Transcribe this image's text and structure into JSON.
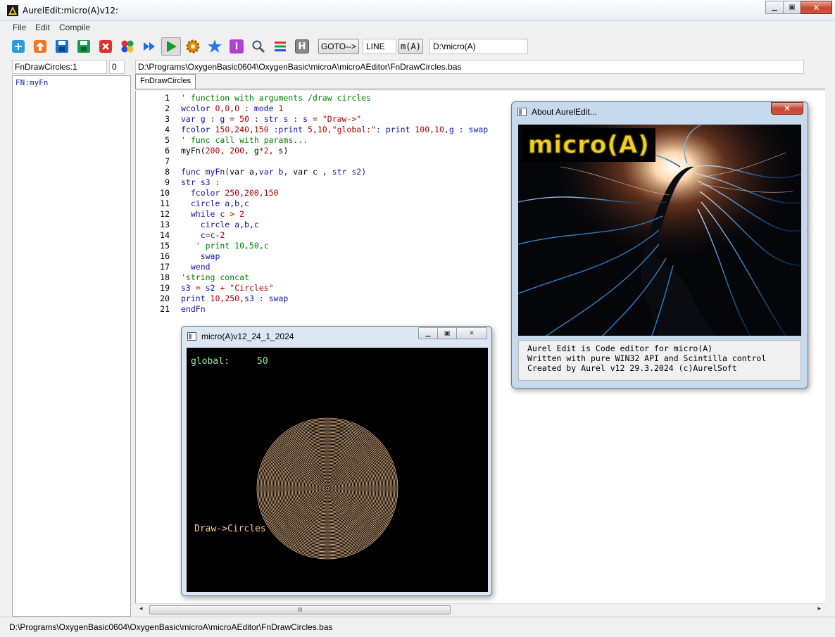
{
  "window": {
    "title": "AurelEdit:micro(A)v12:",
    "minimize_glyph": "▁",
    "maximize_glyph": "▣",
    "close_glyph": "✕"
  },
  "menu": {
    "items": [
      {
        "label": "File"
      },
      {
        "label": "Edit"
      },
      {
        "label": "Compile"
      }
    ]
  },
  "toolbar": {
    "goto_label": "GOTO-->",
    "line_value": "LINE",
    "ma_label": "m(A)",
    "path_value": "D:\\micro(A)",
    "info_glyph": "i",
    "h_glyph": "H"
  },
  "row2": {
    "function_name": "FnDrawCircles:1",
    "number": "0",
    "file_path": "D:\\Programs\\OxygenBasic0604\\OxygenBasic\\microA\\microAEditor\\FnDrawCircles.bas"
  },
  "sidebar": {
    "items": [
      {
        "label": "FN:myFn"
      }
    ]
  },
  "editor": {
    "tab_label": "FnDrawCircles",
    "line_numbers": [
      "1",
      "2",
      "3",
      "4",
      "5",
      "6",
      "7",
      "8",
      "9",
      "10",
      "11",
      "12",
      "13",
      "14",
      "15",
      "16",
      "17",
      "18",
      "19",
      "20",
      "21"
    ],
    "lines": [
      [
        [
          "c-com",
          "' function with arguments /draw circles"
        ]
      ],
      [
        [
          "c-kw",
          "wcolor "
        ],
        [
          "c-num",
          "0,0,0"
        ],
        [
          "c-kw",
          " : mode "
        ],
        [
          "c-num",
          "1"
        ]
      ],
      [
        [
          "c-kw",
          "var g : g "
        ],
        [
          "c-op",
          "="
        ],
        [
          "c-num",
          " 50"
        ],
        [
          "c-kw",
          " : str s : s "
        ],
        [
          "c-op",
          "="
        ],
        [
          "c-str",
          " \"Draw->\""
        ]
      ],
      [
        [
          "c-kw",
          "fcolor "
        ],
        [
          "c-num",
          "150,240,150"
        ],
        [
          "c-kw",
          " :print "
        ],
        [
          "c-num",
          "5,10,"
        ],
        [
          "c-str",
          "\"global:\""
        ],
        [
          "c-kw",
          ": print "
        ],
        [
          "c-num",
          "100,10,"
        ],
        [
          "c-kw",
          "g : swap"
        ]
      ],
      [
        [
          "c-com",
          "' func call with params..."
        ]
      ],
      [
        [
          "c-txt",
          "myFn("
        ],
        [
          "c-num",
          "200, 200,"
        ],
        [
          "c-txt",
          " g"
        ],
        [
          "c-op",
          "*"
        ],
        [
          "c-num",
          "2,"
        ],
        [
          "c-txt",
          " s)"
        ]
      ],
      [
        [
          "c-txt",
          ""
        ]
      ],
      [
        [
          "c-kw",
          "func myFn("
        ],
        [
          "c-txt",
          "var a,"
        ],
        [
          "c-kw",
          "var b, "
        ],
        [
          "c-txt",
          "var c , "
        ],
        [
          "c-kw",
          "str s2)"
        ]
      ],
      [
        [
          "c-kw",
          "str s3 :"
        ]
      ],
      [
        [
          "c-kw",
          "  fcolor "
        ],
        [
          "c-num",
          "250,200,150"
        ]
      ],
      [
        [
          "c-kw",
          "  circle a,b,c"
        ]
      ],
      [
        [
          "c-kw",
          "  while c "
        ],
        [
          "c-op",
          "> "
        ],
        [
          "c-num",
          "2"
        ]
      ],
      [
        [
          "c-kw",
          "    circle a,b,c"
        ]
      ],
      [
        [
          "c-kw",
          "    c"
        ],
        [
          "c-op",
          "="
        ],
        [
          "c-kw",
          "c"
        ],
        [
          "c-op",
          "-"
        ],
        [
          "c-num",
          "2"
        ]
      ],
      [
        [
          "c-com",
          "   ' print 10,50,c"
        ]
      ],
      [
        [
          "c-kw",
          "    swap"
        ]
      ],
      [
        [
          "c-kw",
          "  wend"
        ]
      ],
      [
        [
          "c-com",
          "'string concat"
        ]
      ],
      [
        [
          "c-kw",
          "s3 "
        ],
        [
          "c-op",
          "="
        ],
        [
          "c-kw",
          " s2 "
        ],
        [
          "c-op",
          "+"
        ],
        [
          "c-str",
          " \"Circles\""
        ]
      ],
      [
        [
          "c-kw",
          "print "
        ],
        [
          "c-num",
          "10,250,"
        ],
        [
          "c-kw",
          "s3 : swap"
        ]
      ],
      [
        [
          "c-kw",
          "endFn"
        ]
      ]
    ],
    "hscroll_grip": "III"
  },
  "run_window": {
    "title": "micro(A)v12_24_1_2024",
    "global_label": "global:",
    "global_value": "50",
    "output_text": "Draw->Circles",
    "circle_color": "#fac896",
    "radius_outer": 100,
    "radius_step": 2
  },
  "about_window": {
    "title": "About AurelEdit...",
    "logo_text": "micro(A)",
    "text_lines": [
      "Aurel Edit is Code editor for micro(A)",
      "Written with pure WIN32 API and Scintilla control",
      "Created by Aurel v12 29.3.2024 (c)AurelSoft"
    ]
  },
  "statusbar": {
    "text": "D:\\Programs\\OxygenBasic0604\\OxygenBasic\\microA\\microAEditor\\FnDrawCircles.bas"
  },
  "colors": {
    "comment": "#008000",
    "keyword": "#1010b0",
    "number": "#b00000"
  }
}
